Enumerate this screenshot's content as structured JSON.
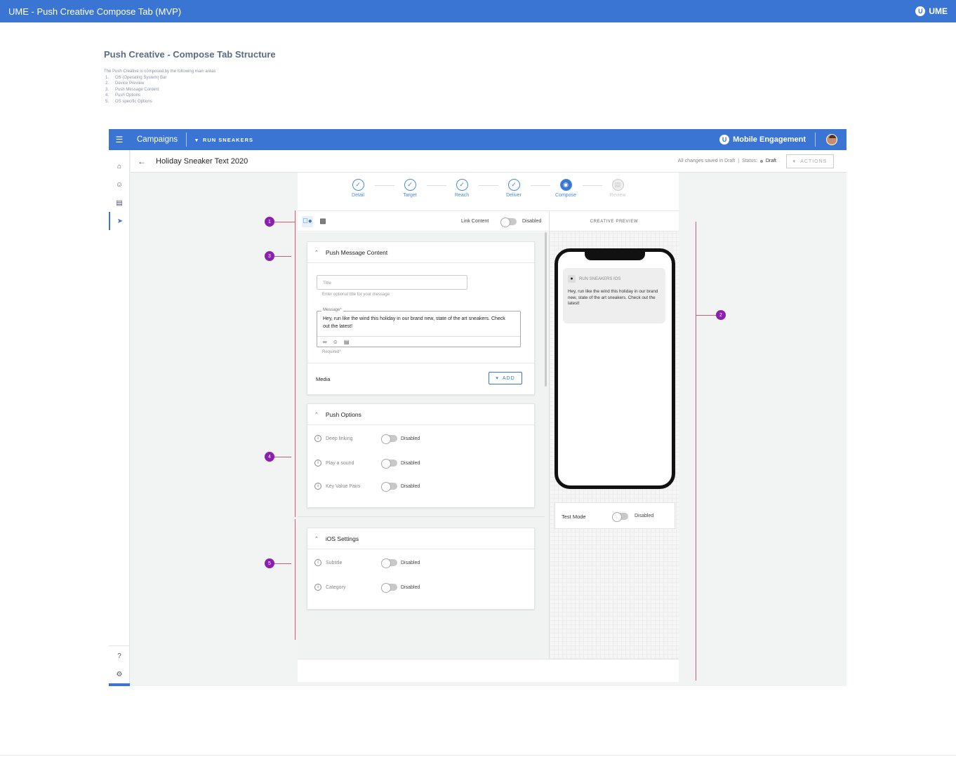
{
  "topbar": {
    "title": "UME - Push Creative Compose Tab (MVP)",
    "brand": "UME",
    "brand_logo": "U"
  },
  "doc": {
    "heading": "Push Creative - Compose Tab Structure",
    "intro": "The Push Creative is composed by the following main areas",
    "areas": [
      {
        "n": "1.",
        "label": "OS (Operating System) Bar"
      },
      {
        "n": "2.",
        "label": "Device Preview"
      },
      {
        "n": "3.",
        "label": "Push Message Content"
      },
      {
        "n": "4.",
        "label": "Push Options"
      },
      {
        "n": "5.",
        "label": "OS specific Options"
      }
    ]
  },
  "app_header": {
    "section": "Campaigns",
    "project": "RUN SNEAKERS",
    "product": "Mobile Engagement",
    "logo": "U"
  },
  "subheader": {
    "campaign_title": "Holiday Sneaker Text 2020",
    "save_status": "All changes saved in Draft",
    "separator": "|",
    "status_label": "Status:",
    "status_value": "Draft",
    "actions_label": "ACTIONS"
  },
  "stepper": [
    {
      "label": "Detail",
      "state": "done"
    },
    {
      "label": "Target",
      "state": "done"
    },
    {
      "label": "Reach",
      "state": "done"
    },
    {
      "label": "Deliver",
      "state": "done"
    },
    {
      "label": "Compose",
      "state": "current"
    },
    {
      "label": "Review",
      "state": "disabled"
    }
  ],
  "os_bar": {
    "selected_os": "apple-icon",
    "other_os": "android-icon",
    "link_content_label": "Link Content",
    "link_content_state": "Disabled"
  },
  "push_message": {
    "header": "Push Message Content",
    "title_placeholder": "Title",
    "title_hint": "Enter optional title for your message",
    "message_label": "Message*",
    "message_value": "Hey, run like the wind this holiday in our brand new, state of the art sneakers. Check out the latest!",
    "required_hint": "Required*",
    "media_label": "Media",
    "add_label": "ADD"
  },
  "push_options": {
    "header": "Push Options",
    "items": [
      {
        "label": "Deep linking",
        "state": "Disabled"
      },
      {
        "label": "Play a sound",
        "state": "Disabled"
      },
      {
        "label": "Key Value Pairs",
        "state": "Disabled"
      }
    ]
  },
  "ios_settings": {
    "header": "iOS Settings",
    "items": [
      {
        "label": "Subtitle",
        "state": "Disabled"
      },
      {
        "label": "Category",
        "state": "Disabled"
      }
    ]
  },
  "preview": {
    "header": "CREATIVE PREVIEW",
    "app_name": "RUN SNEAKERS IOS",
    "notification_text": "Hey, run like the wind this holiday in our brand new, state of the art sneakers. Check out the latest!",
    "test_mode_label": "Test Mode",
    "test_mode_state": "Disabled"
  },
  "markers": [
    "1",
    "2",
    "3",
    "4",
    "5"
  ],
  "colors": {
    "brand_blue": "#3a75d4",
    "marker_purple": "#8a1fb0",
    "annotation_line": "#d35a78"
  }
}
